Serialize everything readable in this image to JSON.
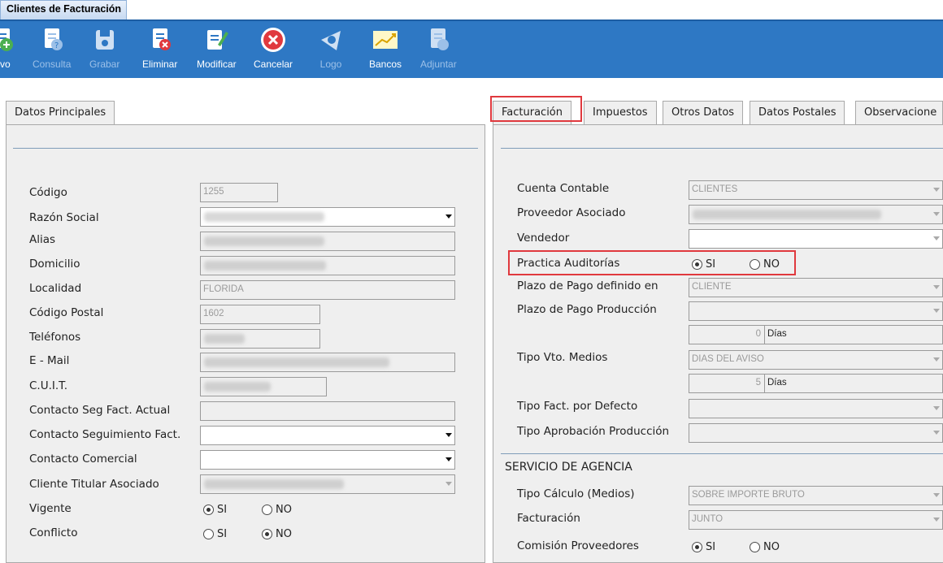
{
  "window": {
    "tab_title": "Clientes de Facturación"
  },
  "toolbar": {
    "buttons": [
      {
        "label": "evo",
        "enabled": true,
        "icon": "new-icon"
      },
      {
        "label": "Consulta",
        "enabled": false,
        "icon": "query-icon"
      },
      {
        "label": "Grabar",
        "enabled": false,
        "icon": "save-icon"
      },
      {
        "label": "Eliminar",
        "enabled": true,
        "icon": "delete-icon"
      },
      {
        "label": "Modificar",
        "enabled": true,
        "icon": "edit-icon"
      },
      {
        "label": "Cancelar",
        "enabled": true,
        "icon": "cancel-icon"
      },
      {
        "label": "Logo",
        "enabled": false,
        "icon": "logo-icon"
      },
      {
        "label": "Bancos",
        "enabled": true,
        "icon": "chart-icon"
      },
      {
        "label": "Adjuntar",
        "enabled": false,
        "icon": "attach-icon"
      }
    ]
  },
  "left": {
    "tab": "Datos Principales",
    "labels": {
      "codigo": "Código",
      "razon_social": "Razón Social",
      "alias": "Alias",
      "domicilio": "Domicilio",
      "localidad": "Localidad",
      "codigo_postal": "Código Postal",
      "telefonos": "Teléfonos",
      "email": "E - Mail",
      "cuit": "C.U.I.T.",
      "contacto_seg_actual": "Contacto Seg Fact. Actual",
      "contacto_seguimiento": "Contacto Seguimiento Fact.",
      "contacto_comercial": "Contacto Comercial",
      "cliente_titular": "Cliente Titular Asociado",
      "vigente": "Vigente",
      "conflicto": "Conflicto"
    },
    "values": {
      "codigo": "1255",
      "localidad": "FLORIDA",
      "codigo_postal": "1602"
    },
    "radio": {
      "si": "SI",
      "no": "NO",
      "vigente": "SI",
      "conflicto": "NO"
    }
  },
  "right": {
    "tabs": [
      "Facturación",
      "Impuestos",
      "Otros Datos",
      "Datos Postales",
      "Observacione"
    ],
    "active_tab": "Facturación",
    "labels": {
      "cuenta_contable": "Cuenta Contable",
      "proveedor_asociado": "Proveedor Asociado",
      "vendedor": "Vendedor",
      "practica_auditorias": "Practica Auditorías",
      "plazo_pago_definido": "Plazo de Pago definido en",
      "plazo_pago_produccion": "Plazo de Pago Producción",
      "tipo_vto_medios": "Tipo Vto. Medios",
      "tipo_fact_defecto": "Tipo Fact. por Defecto",
      "tipo_aprobacion": "Tipo Aprobación Producción",
      "section_agencia": "SERVICIO DE AGENCIA",
      "tipo_calculo": "Tipo Cálculo (Medios)",
      "facturacion": "Facturación",
      "comision_proveedores": "Comisión Proveedores"
    },
    "values": {
      "cuenta_contable": "CLIENTES",
      "plazo_pago_definido": "CLIENTE",
      "plazo_dias": "0",
      "dias_label": "Días",
      "tipo_vto_medios": "DIAS DEL AVISO",
      "vto_dias": "5",
      "tipo_calculo": "SOBRE IMPORTE BRUTO",
      "facturacion": "JUNTO"
    },
    "radio": {
      "si": "SI",
      "no": "NO",
      "practica_auditorias": "SI",
      "comision_proveedores": "SI"
    }
  },
  "colors": {
    "toolbar": "#2e78c4",
    "highlight": "#e0393e",
    "panel": "#efefef"
  }
}
